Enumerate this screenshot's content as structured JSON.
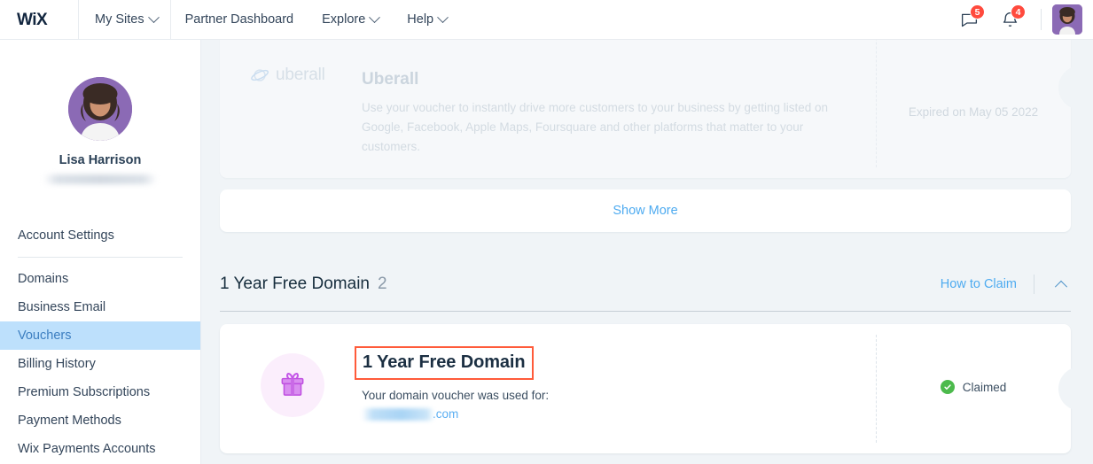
{
  "topbar": {
    "logo": "WiX",
    "logo_icon": "wix-logo-icon",
    "items": [
      {
        "label": "My Sites",
        "has_chevron": true
      },
      {
        "label": "Partner Dashboard",
        "has_chevron": false
      },
      {
        "label": "Explore",
        "has_chevron": true
      },
      {
        "label": "Help",
        "has_chevron": true
      }
    ],
    "chat_badge": "5",
    "bell_badge": "4",
    "chat_icon": "chat-bubble-icon",
    "bell_icon": "bell-icon",
    "avatar_icon": "user-avatar"
  },
  "sidebar": {
    "profile_name": "Lisa Harrison",
    "items": [
      {
        "label": "Account Settings",
        "active": false
      },
      {
        "label": "Domains",
        "active": false
      },
      {
        "label": "Business Email",
        "active": false
      },
      {
        "label": "Vouchers",
        "active": true
      },
      {
        "label": "Billing History",
        "active": false
      },
      {
        "label": "Premium Subscriptions",
        "active": false
      },
      {
        "label": "Payment Methods",
        "active": false
      },
      {
        "label": "Wix Payments Accounts",
        "active": false
      }
    ]
  },
  "uberall_card": {
    "logo_text": "uberall",
    "title": "Uberall",
    "description": "Use your voucher to instantly drive more customers to your business by getting listed on Google, Facebook, Apple Maps, Foursquare and other platforms that matter to your customers.",
    "status": "Expired on May 05 2022"
  },
  "show_more": {
    "label": "Show More"
  },
  "section": {
    "title": "1 Year Free Domain",
    "count": "2",
    "how_to_claim": "How to Claim",
    "collapse_icon": "chevron-up-icon"
  },
  "domain_card": {
    "gift_icon": "gift-box-icon",
    "title": "1 Year Free Domain",
    "subtitle": "Your domain voucher was used for:",
    "domain_tld": ".com",
    "status": "Claimed",
    "status_icon": "check-circle-icon"
  },
  "colors": {
    "accent_blue": "#4eabf0",
    "highlight_box": "#ff5b3a",
    "badge_red": "#ff4a3d",
    "claimed_green": "#4cba4c",
    "active_nav_bg": "#bde0fc",
    "page_bg": "#f0f4f7"
  }
}
